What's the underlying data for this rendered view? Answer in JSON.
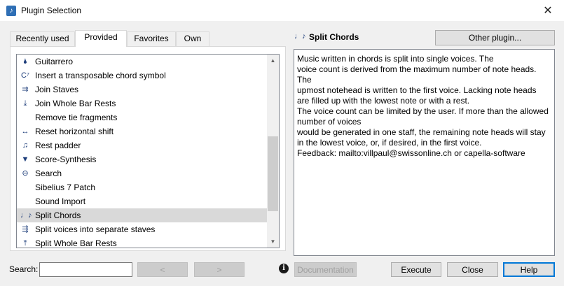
{
  "window": {
    "title": "Plugin Selection",
    "close_glyph": "✕"
  },
  "tabs": [
    {
      "label": "Recently used",
      "active": false
    },
    {
      "label": "Provided",
      "active": true
    },
    {
      "label": "Favorites",
      "active": false
    },
    {
      "label": "Own",
      "active": false
    }
  ],
  "plugins": [
    {
      "label": "Guitarrero",
      "icon": "guitar-icon",
      "glyph": "🌢"
    },
    {
      "label": "Insert a transposable chord symbol",
      "icon": "chord-symbol-icon",
      "glyph": "C⁷"
    },
    {
      "label": "Join Staves",
      "icon": "join-staves-icon",
      "glyph": "⇉"
    },
    {
      "label": "Join Whole Bar Rests",
      "icon": "join-rests-icon",
      "glyph": "⤓"
    },
    {
      "label": "Remove tie fragments",
      "icon": "",
      "glyph": ""
    },
    {
      "label": "Reset horizontal shift",
      "icon": "reset-shift-icon",
      "glyph": "↔"
    },
    {
      "label": "Rest padder",
      "icon": "rest-padder-icon",
      "glyph": "♫"
    },
    {
      "label": "Score-Synthesis",
      "icon": "score-synthesis-icon",
      "glyph": "▼"
    },
    {
      "label": "Search",
      "icon": "search-icon",
      "glyph": "⊖"
    },
    {
      "label": "Sibelius 7 Patch",
      "icon": "",
      "glyph": ""
    },
    {
      "label": "Sound Import",
      "icon": "",
      "glyph": ""
    },
    {
      "label": "Split Chords",
      "icon": "split-chords-icon",
      "glyph": "♩♪",
      "selected": true
    },
    {
      "label": "Split voices into separate staves",
      "icon": "split-voices-icon",
      "glyph": "⇶"
    },
    {
      "label": "Split Whole Bar Rests",
      "icon": "split-rests-icon",
      "glyph": "⤒"
    }
  ],
  "detail": {
    "icon_glyph": "♩♪",
    "title": "Split Chords",
    "other_plugin_label": "Other plugin...",
    "description": "Music written in chords is split into single voices. The\nvoice count is derived from the maximum number of note heads.\nThe\nupmost notehead is written to the first voice. Lacking note heads\nare filled up with the lowest note or with a rest.\nThe voice count can be limited by the user. If more than the allowed\nnumber of voices\nwould be generated in one staff, the remaining note heads will stay\nin the lowest voice, or, if desired, in the first voice.\nFeedback: mailto:villpaul@swissonline.ch or capella-software"
  },
  "search": {
    "label": "Search:",
    "value": ""
  },
  "nav": {
    "prev": "<",
    "next": ">"
  },
  "buttons": {
    "documentation": "Documentation",
    "execute": "Execute",
    "close": "Close",
    "help": "Help"
  }
}
